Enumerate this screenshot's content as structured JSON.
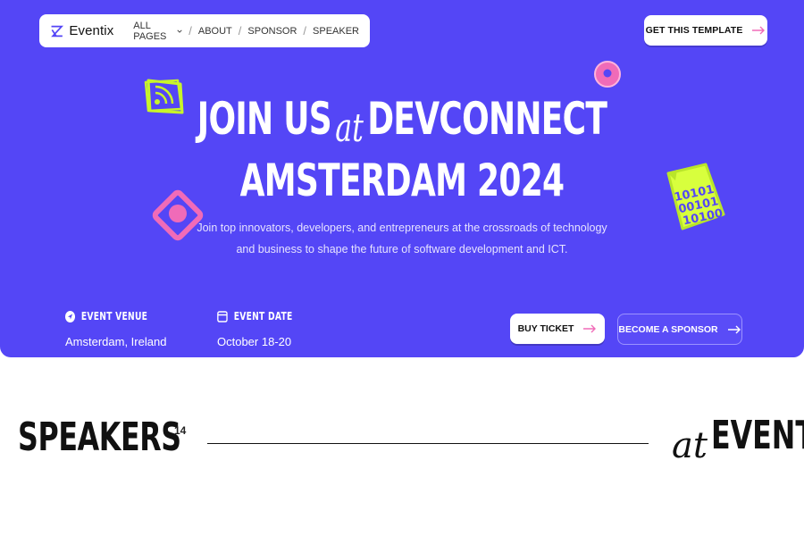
{
  "nav": {
    "logo": "Eventix",
    "items": [
      "ALL PAGES",
      "ABOUT",
      "SPONSOR",
      "SPEAKER"
    ],
    "separator": "/",
    "cta": "GET THIS TEMPLATE"
  },
  "hero": {
    "line1_a": "JOIN US",
    "line1_at": "at",
    "line1_b": "DEVCONNECT",
    "line2": "AMSTERDAM 2024",
    "subtitle_1": "Join top innovators, developers, and entrepreneurs at the crossroads of technology",
    "subtitle_2": "and business to shape the future of software development and ICT.",
    "badge_binary": [
      "10101",
      "00101",
      "10100"
    ]
  },
  "info": {
    "venue_label": "EVENT VENUE",
    "venue_value": "Amsterdam, Ireland",
    "date_label": "EVENT DATE",
    "date_value": "October 18-20"
  },
  "buttons": {
    "ticket": "BUY TICKET",
    "sponsor": "BECOME A SPONSOR"
  },
  "speakers": {
    "title": "SPEAKERS",
    "count": "14",
    "right_at": "at",
    "right_word": "EVENT"
  },
  "colors": {
    "hero_bg": "#5446f6",
    "accent_pink": "#f06bb8",
    "accent_lime": "#c8f52a"
  }
}
